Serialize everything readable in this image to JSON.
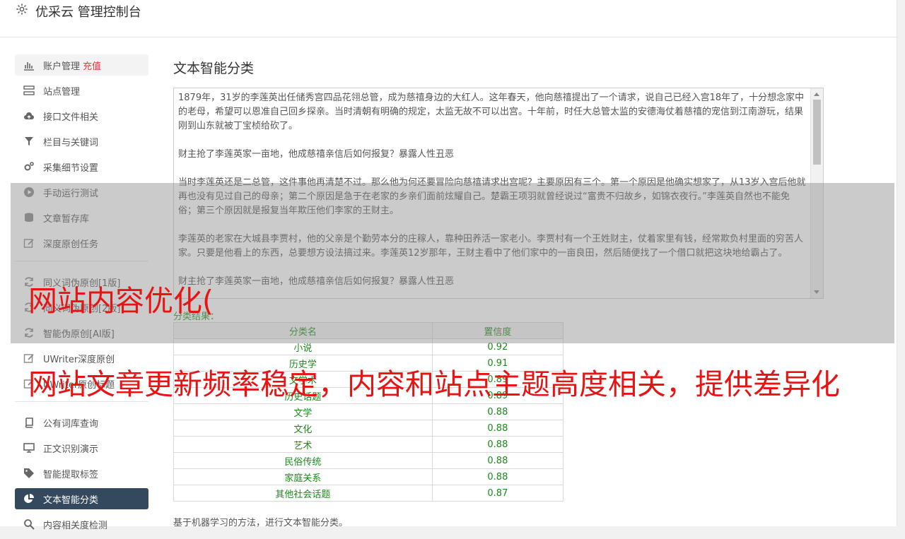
{
  "header": {
    "title": "优采云 管理控制台",
    "icon": "gear-icon"
  },
  "sidebar": {
    "items": [
      {
        "label": "账户管理",
        "badge": "充值",
        "icon": "bar-chart-icon"
      },
      {
        "label": "站点管理",
        "icon": "server-icon"
      },
      {
        "label": "接口文件相关",
        "icon": "cloud-upload-icon"
      },
      {
        "label": "栏目与关键词",
        "icon": "filter-icon"
      },
      {
        "label": "采集细节设置",
        "icon": "cogs-icon"
      },
      {
        "label": "手动运行测试",
        "icon": "play-icon"
      },
      {
        "label": "文章暂存库",
        "icon": "database-icon"
      },
      {
        "label": "深度原创任务",
        "icon": "edit-icon"
      },
      {
        "label": "同义词伪原创[1版]",
        "icon": "refresh-icon"
      },
      {
        "label": "同义词伪原创[2版]",
        "icon": "refresh-icon"
      },
      {
        "label": "智能伪原创[AI版]",
        "icon": "refresh-icon"
      },
      {
        "label": "UWriter深度原创",
        "icon": "edit-icon"
      },
      {
        "label": "UWriter原创标题",
        "icon": "edit-icon"
      },
      {
        "label": "公有词库查询",
        "icon": "book-icon"
      },
      {
        "label": "正文识别演示",
        "icon": "monitor-icon"
      },
      {
        "label": "智能提取标签",
        "icon": "tag-icon"
      },
      {
        "label": "文本智能分类",
        "icon": "pie-chart-icon"
      },
      {
        "label": "内容相关度检测",
        "icon": "search-icon"
      }
    ]
  },
  "main": {
    "title": "文本智能分类",
    "text_paragraphs": [
      "1879年，31岁的李莲英出任储秀宫四品花翎总管，成为慈禧身边的大红人。这年春天，他向慈禧提出了一个请求，说自己已经入宫18年了，十分想念家中的老母，希望可以恩准自己回乡探亲。当时清朝有明确的规定，太监无故不可以出宫。十年前，时任大总管太监的安德海仗着慈禧的宠信到江南游玩，结果刚到山东就被丁宝桢给砍了。",
      "财主抢了李莲英家一亩地，他成慈禧亲信后如何报复？暴露人性丑恶",
      "当时李莲英还是二总管，这件事他再清楚不过。那么他为何还要冒险向慈禧请求出宫呢？主要原因有三个。第一个原因是他确实想家了，从13岁入宫后他就再也没有见过自己的母亲；第二个原因是急于在老家的乡亲们面前炫耀自己。楚霸王项羽就曾经说过“富贵不归故乡，如锦衣夜行。”李莲英自然也不能免俗；第三个原因就是报复当年欺压他们李家的王财主。",
      "李莲英的老家在大城县李贾村，他的父亲是个勤劳本分的庄稼人，靠种田养活一家老小。李贾村有一个王姓财主，仗着家里有钱，经常欺负村里面的穷苦人家。只要是他看上的东西，总要想方设法搞过来。李莲英12岁那年，王财主看中了他们家中的一亩良田，然后随便找了一个借口就把这块地给霸占了。",
      "财主抢了李莲英家一亩地，他成慈禧亲信后如何报复？暴露人性丑恶"
    ],
    "result_label": "分类结果：",
    "table": {
      "headers": [
        "分类名",
        "置信度"
      ],
      "rows": [
        [
          "小说",
          "0.92"
        ],
        [
          "历史学",
          "0.91"
        ],
        [
          "文学术",
          "0.89"
        ],
        [
          "历史话题",
          "0.89"
        ],
        [
          "文学",
          "0.88"
        ],
        [
          "文化",
          "0.88"
        ],
        [
          "艺术",
          "0.88"
        ],
        [
          "民俗传统",
          "0.88"
        ],
        [
          "家庭关系",
          "0.88"
        ],
        [
          "其他社会话题",
          "0.87"
        ]
      ]
    },
    "note": "基于机器学习的方法，进行文本智能分类。"
  },
  "overlay": {
    "line1": "网站内容优化(",
    "line2": "网站文章更新频率稳定，内容和站点主题高度相关，提供差异化"
  },
  "colors": {
    "accent": "#34495e",
    "green": "#1a8a1a",
    "badge": "#e4393c",
    "overlay_text": "#e81313"
  }
}
